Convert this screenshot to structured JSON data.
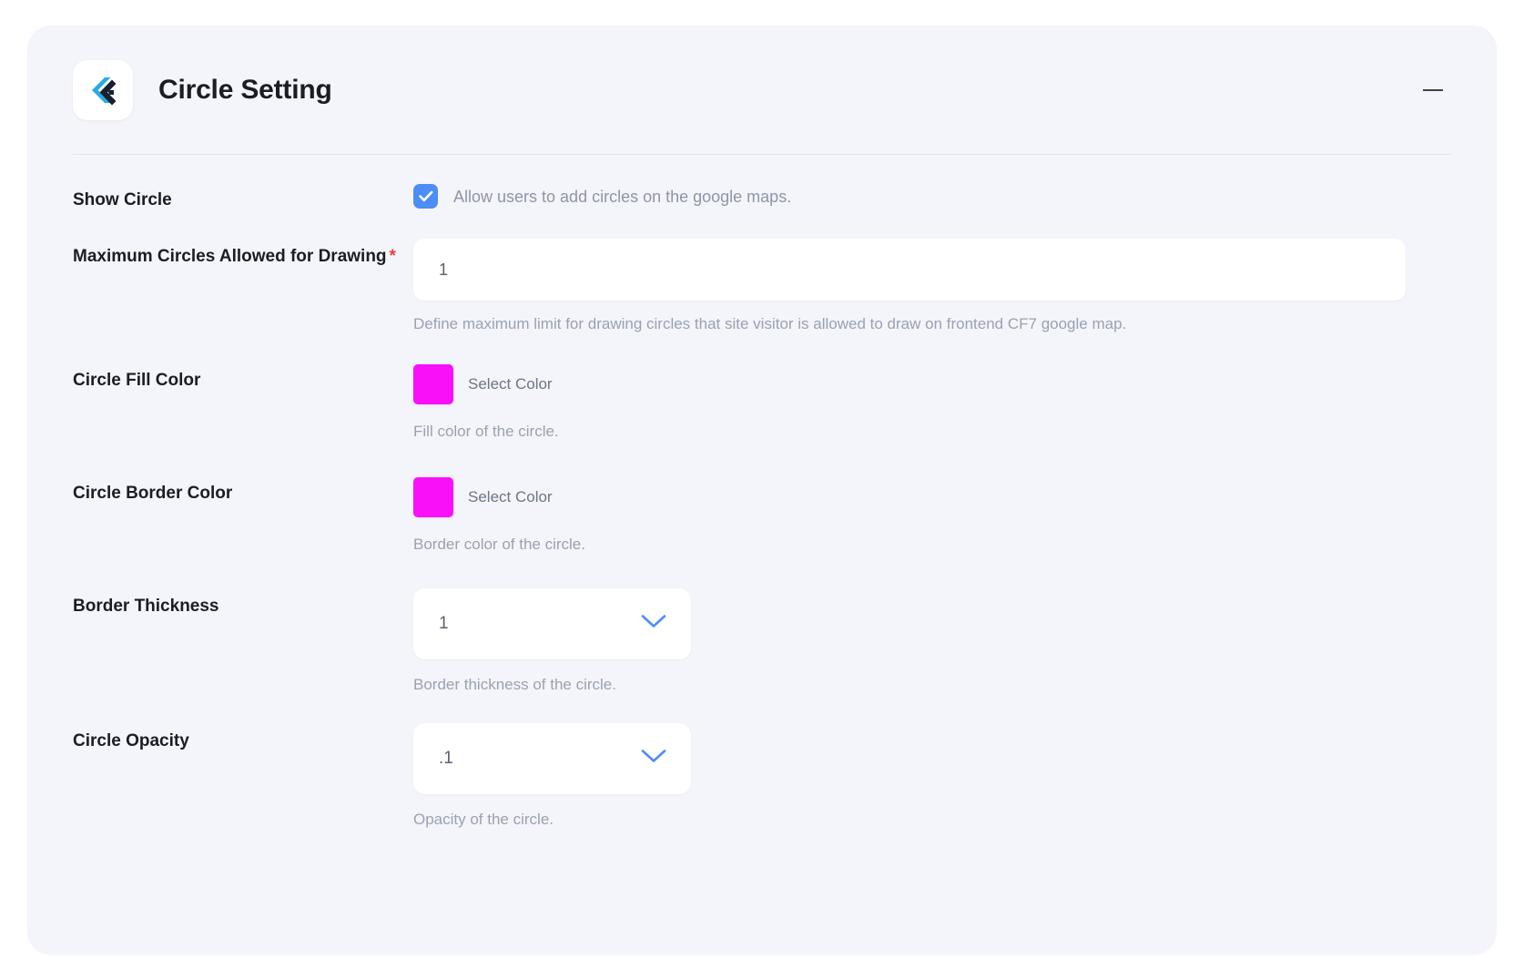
{
  "header": {
    "title": "Circle Setting",
    "logo_icon": "flutter-chevron-logo-icon",
    "minimize_icon": "minimize-icon"
  },
  "rows": {
    "show_circle": {
      "label": "Show Circle",
      "checkbox_checked": true,
      "checkbox_label": "Allow users to add circles on the google maps."
    },
    "max_circles": {
      "label": "Maximum Circles Allowed for Drawing",
      "required_marker": "*",
      "value": "1",
      "placeholder": "1",
      "helper": "Define maximum limit for drawing circles that site visitor is allowed to draw on frontend CF7 google map."
    },
    "fill_color": {
      "label": "Circle Fill Color",
      "swatch_color": "#F910F9",
      "swatch_label": "Select Color",
      "helper": "Fill color of the circle."
    },
    "border_color": {
      "label": "Circle Border Color",
      "swatch_color": "#F910F9",
      "swatch_label": "Select Color",
      "helper": "Border color of the circle."
    },
    "border_thickness": {
      "label": "Border Thickness",
      "value": "1",
      "helper": "Border thickness of the circle.",
      "chevron_icon": "chevron-down-icon"
    },
    "circle_opacity": {
      "label": "Circle Opacity",
      "value": ".1",
      "helper": "Opacity of the circle.",
      "chevron_icon": "chevron-down-icon"
    }
  },
  "colors": {
    "panel_bg": "#F4F5FA",
    "accent_blue": "#4D8DF6",
    "magenta": "#F910F9",
    "required_red": "#F13B3B",
    "logo_cyan": "#29ABE2",
    "logo_navy": "#16202E"
  }
}
